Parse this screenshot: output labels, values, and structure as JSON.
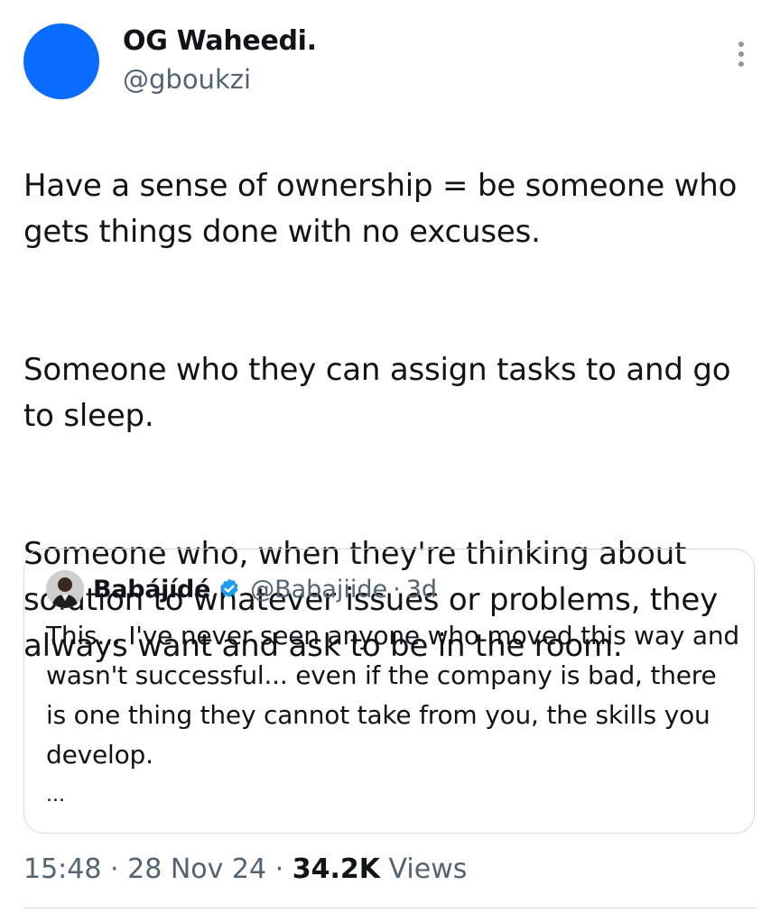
{
  "author": {
    "name": "OG Waheedi.",
    "handle": "@gboukzi",
    "avatar_color": "#0a6cff"
  },
  "more_icon": "more-vertical-icon",
  "tweet": {
    "paragraphs": [
      "Have a sense of ownership = be someone who gets things done with no excuses.",
      "Someone who they can assign tasks to and go to sleep.",
      "Someone who, when they're thinking about solution to whatever issues or problems, they always want and ask to be in the room."
    ]
  },
  "quote": {
    "name": "Babájídé",
    "verified_icon": "verified-badge-icon",
    "handle": "@Babajiide",
    "separator": "·",
    "time": "3d",
    "text": "This... I've never seen anyone who moved this way and wasn't successful... even if the company is bad, there is one thing they cannot take from you, the skills you develop.",
    "ellipsis": "..."
  },
  "meta": {
    "time": "15:48",
    "sep1": "·",
    "date": "28 Nov 24",
    "sep2": "·",
    "views_count": "34.2K",
    "views_label": "Views"
  },
  "colors": {
    "text": "#0f1419",
    "secondary": "#536471",
    "border": "#cfd9de",
    "verified": "#1d9bf0"
  }
}
